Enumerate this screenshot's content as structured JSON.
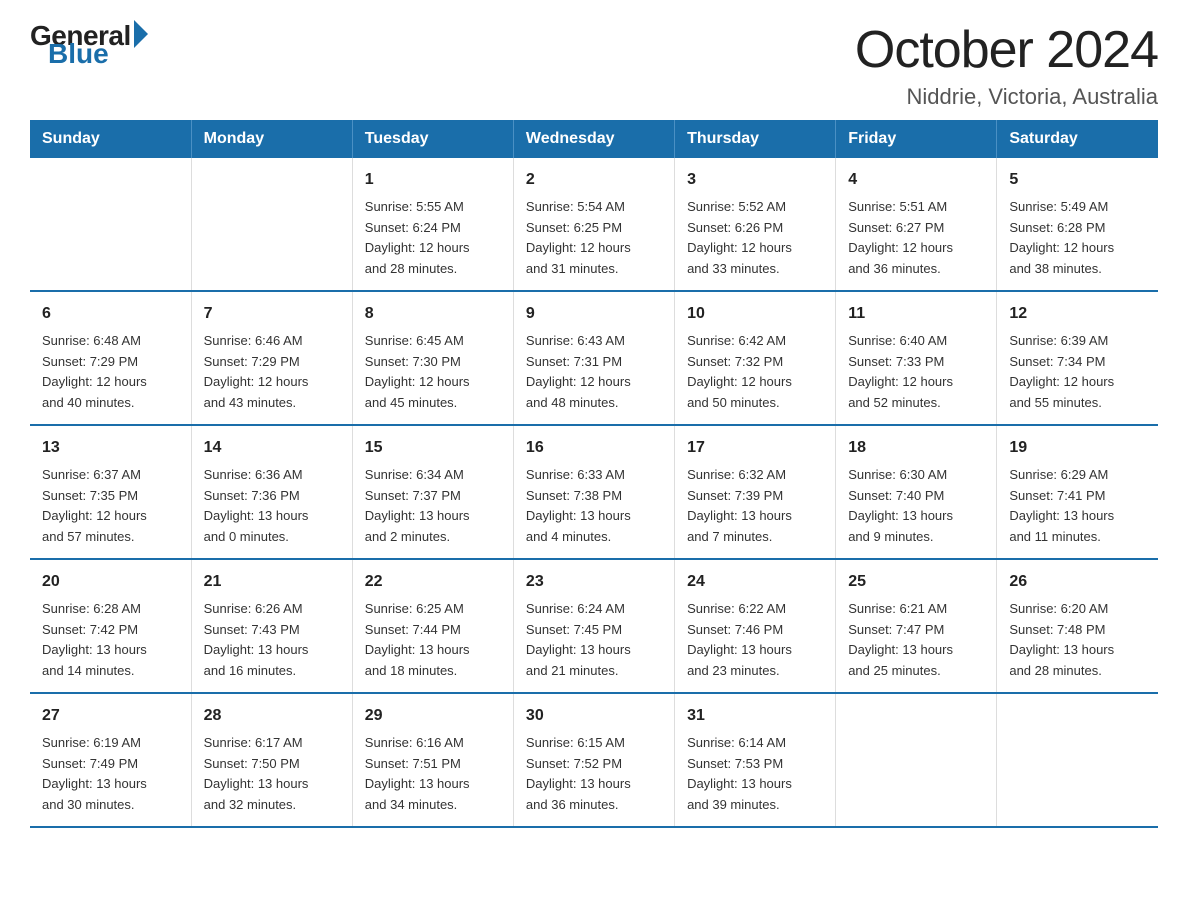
{
  "logo": {
    "general": "General",
    "blue": "Blue"
  },
  "header": {
    "month": "October 2024",
    "location": "Niddrie, Victoria, Australia"
  },
  "weekdays": [
    "Sunday",
    "Monday",
    "Tuesday",
    "Wednesday",
    "Thursday",
    "Friday",
    "Saturday"
  ],
  "weeks": [
    [
      {
        "day": "",
        "info": ""
      },
      {
        "day": "",
        "info": ""
      },
      {
        "day": "1",
        "info": "Sunrise: 5:55 AM\nSunset: 6:24 PM\nDaylight: 12 hours\nand 28 minutes."
      },
      {
        "day": "2",
        "info": "Sunrise: 5:54 AM\nSunset: 6:25 PM\nDaylight: 12 hours\nand 31 minutes."
      },
      {
        "day": "3",
        "info": "Sunrise: 5:52 AM\nSunset: 6:26 PM\nDaylight: 12 hours\nand 33 minutes."
      },
      {
        "day": "4",
        "info": "Sunrise: 5:51 AM\nSunset: 6:27 PM\nDaylight: 12 hours\nand 36 minutes."
      },
      {
        "day": "5",
        "info": "Sunrise: 5:49 AM\nSunset: 6:28 PM\nDaylight: 12 hours\nand 38 minutes."
      }
    ],
    [
      {
        "day": "6",
        "info": "Sunrise: 6:48 AM\nSunset: 7:29 PM\nDaylight: 12 hours\nand 40 minutes."
      },
      {
        "day": "7",
        "info": "Sunrise: 6:46 AM\nSunset: 7:29 PM\nDaylight: 12 hours\nand 43 minutes."
      },
      {
        "day": "8",
        "info": "Sunrise: 6:45 AM\nSunset: 7:30 PM\nDaylight: 12 hours\nand 45 minutes."
      },
      {
        "day": "9",
        "info": "Sunrise: 6:43 AM\nSunset: 7:31 PM\nDaylight: 12 hours\nand 48 minutes."
      },
      {
        "day": "10",
        "info": "Sunrise: 6:42 AM\nSunset: 7:32 PM\nDaylight: 12 hours\nand 50 minutes."
      },
      {
        "day": "11",
        "info": "Sunrise: 6:40 AM\nSunset: 7:33 PM\nDaylight: 12 hours\nand 52 minutes."
      },
      {
        "day": "12",
        "info": "Sunrise: 6:39 AM\nSunset: 7:34 PM\nDaylight: 12 hours\nand 55 minutes."
      }
    ],
    [
      {
        "day": "13",
        "info": "Sunrise: 6:37 AM\nSunset: 7:35 PM\nDaylight: 12 hours\nand 57 minutes."
      },
      {
        "day": "14",
        "info": "Sunrise: 6:36 AM\nSunset: 7:36 PM\nDaylight: 13 hours\nand 0 minutes."
      },
      {
        "day": "15",
        "info": "Sunrise: 6:34 AM\nSunset: 7:37 PM\nDaylight: 13 hours\nand 2 minutes."
      },
      {
        "day": "16",
        "info": "Sunrise: 6:33 AM\nSunset: 7:38 PM\nDaylight: 13 hours\nand 4 minutes."
      },
      {
        "day": "17",
        "info": "Sunrise: 6:32 AM\nSunset: 7:39 PM\nDaylight: 13 hours\nand 7 minutes."
      },
      {
        "day": "18",
        "info": "Sunrise: 6:30 AM\nSunset: 7:40 PM\nDaylight: 13 hours\nand 9 minutes."
      },
      {
        "day": "19",
        "info": "Sunrise: 6:29 AM\nSunset: 7:41 PM\nDaylight: 13 hours\nand 11 minutes."
      }
    ],
    [
      {
        "day": "20",
        "info": "Sunrise: 6:28 AM\nSunset: 7:42 PM\nDaylight: 13 hours\nand 14 minutes."
      },
      {
        "day": "21",
        "info": "Sunrise: 6:26 AM\nSunset: 7:43 PM\nDaylight: 13 hours\nand 16 minutes."
      },
      {
        "day": "22",
        "info": "Sunrise: 6:25 AM\nSunset: 7:44 PM\nDaylight: 13 hours\nand 18 minutes."
      },
      {
        "day": "23",
        "info": "Sunrise: 6:24 AM\nSunset: 7:45 PM\nDaylight: 13 hours\nand 21 minutes."
      },
      {
        "day": "24",
        "info": "Sunrise: 6:22 AM\nSunset: 7:46 PM\nDaylight: 13 hours\nand 23 minutes."
      },
      {
        "day": "25",
        "info": "Sunrise: 6:21 AM\nSunset: 7:47 PM\nDaylight: 13 hours\nand 25 minutes."
      },
      {
        "day": "26",
        "info": "Sunrise: 6:20 AM\nSunset: 7:48 PM\nDaylight: 13 hours\nand 28 minutes."
      }
    ],
    [
      {
        "day": "27",
        "info": "Sunrise: 6:19 AM\nSunset: 7:49 PM\nDaylight: 13 hours\nand 30 minutes."
      },
      {
        "day": "28",
        "info": "Sunrise: 6:17 AM\nSunset: 7:50 PM\nDaylight: 13 hours\nand 32 minutes."
      },
      {
        "day": "29",
        "info": "Sunrise: 6:16 AM\nSunset: 7:51 PM\nDaylight: 13 hours\nand 34 minutes."
      },
      {
        "day": "30",
        "info": "Sunrise: 6:15 AM\nSunset: 7:52 PM\nDaylight: 13 hours\nand 36 minutes."
      },
      {
        "day": "31",
        "info": "Sunrise: 6:14 AM\nSunset: 7:53 PM\nDaylight: 13 hours\nand 39 minutes."
      },
      {
        "day": "",
        "info": ""
      },
      {
        "day": "",
        "info": ""
      }
    ]
  ]
}
